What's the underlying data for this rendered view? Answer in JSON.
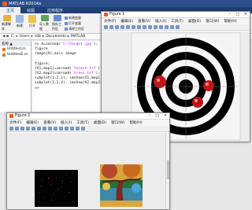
{
  "main": {
    "title": "MATLAB R2014a",
    "tabs": [
      "主页",
      "绘图",
      "应用程序"
    ],
    "ribbon": {
      "buttons": [
        "新建脚本",
        "新建",
        "打开",
        "导入数据",
        "保存工作区"
      ],
      "small": [
        "新建变量",
        "打开变量",
        "清除工作区"
      ]
    },
    "address": [
      "C:",
      "Users",
      "sdb",
      "Documents",
      "MATLAB"
    ]
  },
  "filepanel": {
    "header": "名称 ▲",
    "files": [
      "Untitled.m",
      "Untitled2.m"
    ]
  },
  "cmd": {
    "lines": [
      {
        "code": ">> A=imread(",
        "str": "'C:\\target.jpg'",
        "end": ");"
      },
      {
        "code": "figure",
        "str": "",
        "end": ""
      },
      {
        "code": "image(A);axis image",
        "str": "",
        "end": ""
      },
      {
        "code": "",
        "str": "",
        "end": ""
      },
      {
        "code": "figure;",
        "str": "",
        "end": ""
      },
      {
        "code": "[X1,map1]=imread(",
        "str": "'forest.tif'",
        "end": ");"
      },
      {
        "code": "[X2,map2]=imread(",
        "str": "'trees.tif'",
        "end": ");"
      },
      {
        "code": "subplot(1,2,1), imshow(X1,map1)",
        "str": "",
        "end": ""
      },
      {
        "code": "subplot(1,2,2), imshow(X2,map2)",
        "str": "",
        "end": ""
      },
      {
        "code": ">>",
        "str": "",
        "end": ""
      }
    ]
  },
  "fig1": {
    "title": "Figure 1",
    "menu": [
      "文件(F)",
      "编辑(E)",
      "查看(V)",
      "插入(I)",
      "工具(T)",
      "桌面(D)",
      "窗口(W)",
      "帮助(H)"
    ]
  },
  "fig2": {
    "title": "Figure 2",
    "menu": [
      "文件(F)",
      "编辑(E)",
      "查看(V)",
      "插入(I)",
      "工具(T)",
      "桌面(D)",
      "窗口(W)",
      "帮助(H)"
    ]
  },
  "colors": {
    "title_bar": "#2a4f8a",
    "tab_bar": "#1e3f73",
    "string": "#a020f0",
    "target_red": "#c01818"
  }
}
